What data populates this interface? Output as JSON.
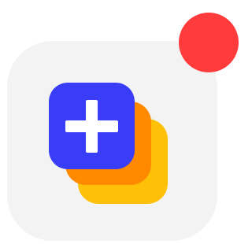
{
  "app_icon": {
    "name": "add-to-stack-app-icon",
    "icon_name": "add-layers-icon",
    "background_color": "#f3f3f3"
  },
  "layers": {
    "back_color": "#ffc107",
    "middle_color": "#ff8a00",
    "front_color": "#3a3df7",
    "plus_color": "#ffffff"
  },
  "badge": {
    "icon_name": "notification-dot-icon",
    "color": "#ff3b3b"
  }
}
